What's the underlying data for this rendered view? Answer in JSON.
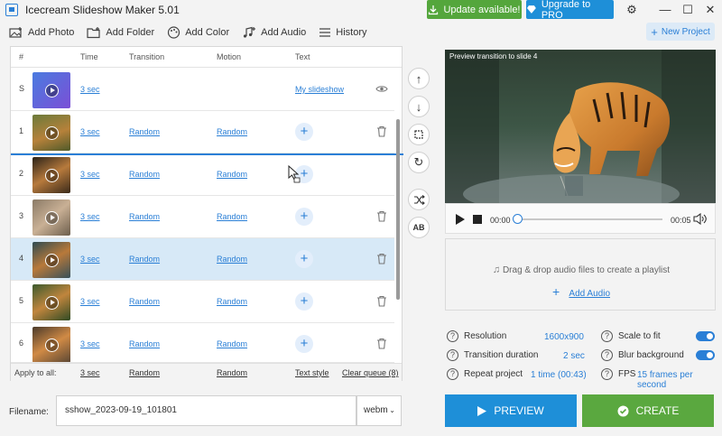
{
  "app": {
    "title": "Icecream Slideshow Maker 5.01",
    "update_label": "Update available!",
    "upgrade_label": "Upgrade to PRO"
  },
  "toolbar": {
    "add_photo": "Add Photo",
    "add_folder": "Add Folder",
    "add_color": "Add Color",
    "add_audio": "Add Audio",
    "history": "History",
    "new_project": "New Project"
  },
  "list": {
    "headers": {
      "num": "#",
      "time": "Time",
      "transition": "Transition",
      "motion": "Motion",
      "text": "Text"
    },
    "rows": [
      {
        "num": "S",
        "time": "3 sec",
        "transition": "",
        "motion": "",
        "text": "My slideshow",
        "kind": "title"
      },
      {
        "num": "1",
        "time": "3 sec",
        "transition": "Random",
        "motion": "Random",
        "kind": "photo"
      },
      {
        "num": "2",
        "time": "3 sec",
        "transition": "Random",
        "motion": "Random",
        "kind": "photo"
      },
      {
        "num": "3",
        "time": "3 sec",
        "transition": "Random",
        "motion": "Random",
        "kind": "photo"
      },
      {
        "num": "4",
        "time": "3 sec",
        "transition": "Random",
        "motion": "Random",
        "kind": "photo"
      },
      {
        "num": "5",
        "time": "3 sec",
        "transition": "Random",
        "motion": "Random",
        "kind": "photo"
      },
      {
        "num": "6",
        "time": "3 sec",
        "transition": "Random",
        "motion": "Random",
        "kind": "photo"
      }
    ],
    "apply_all": {
      "label": "Apply to all:",
      "time": "3 sec",
      "transition": "Random",
      "motion": "Random",
      "text_style": "Text style",
      "clear_queue": "Clear queue (8)"
    }
  },
  "filename": {
    "label": "Filename:",
    "value": "sshow_2023-09-19_101801",
    "format": "webm"
  },
  "preview": {
    "caption": "Preview transition to slide 4",
    "time_start": "00:00",
    "time_end": "00:05"
  },
  "audio": {
    "drop_text": "Drag & drop audio files to create a playlist",
    "add_label": "Add Audio"
  },
  "settings": {
    "resolution_label": "Resolution",
    "resolution_value": "1600x900",
    "transition_label": "Transition duration",
    "transition_value": "2 sec",
    "repeat_label": "Repeat project",
    "repeat_value": "1 time (00:43)",
    "scale_label": "Scale to fit",
    "blur_label": "Blur background",
    "fps_label": "FPS",
    "fps_value": "15 frames per second"
  },
  "actions": {
    "preview": "PREVIEW",
    "create": "CREATE"
  },
  "colors": {
    "accent": "#2a7fd6",
    "update_green": "#54a63c",
    "create_green": "#5aa83f",
    "preview_blue": "#1e8fd8"
  }
}
